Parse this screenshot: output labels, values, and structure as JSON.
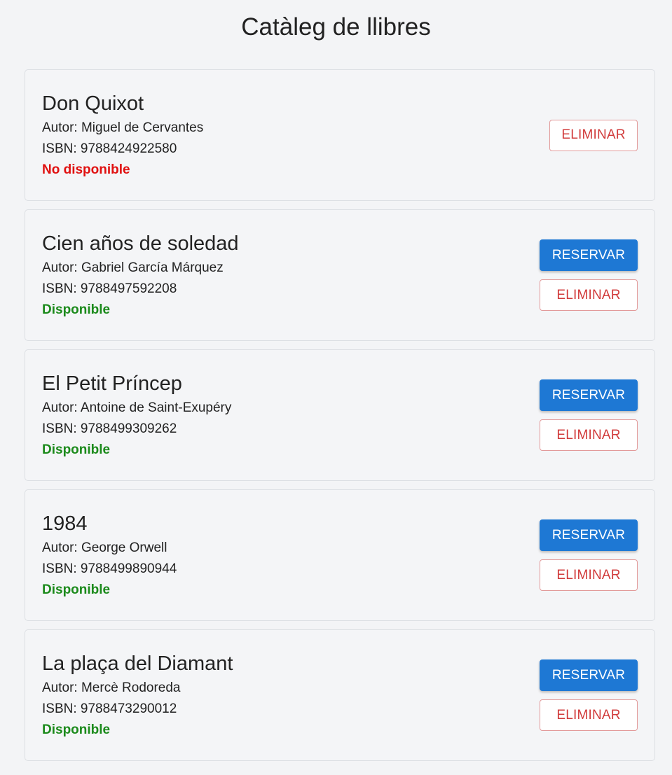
{
  "page": {
    "title": "Catàleg de llibres"
  },
  "colors": {
    "background": "#f3f4f6",
    "reserve_button": "#1e78d4",
    "delete_text": "#d13b3b",
    "available": "#1b8a1b",
    "unavailable": "#e01010"
  },
  "books": [
    {
      "title": "Don Quixot",
      "author": "Autor: Miguel de Cervantes",
      "isbn": "ISBN: 9788424922580",
      "status": "No disponible",
      "available": false,
      "delete_label": "ELIMINAR"
    },
    {
      "title": "Cien años de soledad",
      "author": "Autor: Gabriel García Márquez",
      "isbn": "ISBN: 9788497592208",
      "status": "Disponible",
      "available": true,
      "reserve_label": "RESERVAR",
      "delete_label": "ELIMINAR"
    },
    {
      "title": "El Petit Príncep",
      "author": "Autor: Antoine de Saint-Exupéry",
      "isbn": "ISBN: 9788499309262",
      "status": "Disponible",
      "available": true,
      "reserve_label": "RESERVAR",
      "delete_label": "ELIMINAR"
    },
    {
      "title": "1984",
      "author": "Autor: George Orwell",
      "isbn": "ISBN: 9788499890944",
      "status": "Disponible",
      "available": true,
      "reserve_label": "RESERVAR",
      "delete_label": "ELIMINAR"
    },
    {
      "title": "La plaça del Diamant",
      "author": "Autor: Mercè Rodoreda",
      "isbn": "ISBN: 9788473290012",
      "status": "Disponible",
      "available": true,
      "reserve_label": "RESERVAR",
      "delete_label": "ELIMINAR"
    }
  ]
}
